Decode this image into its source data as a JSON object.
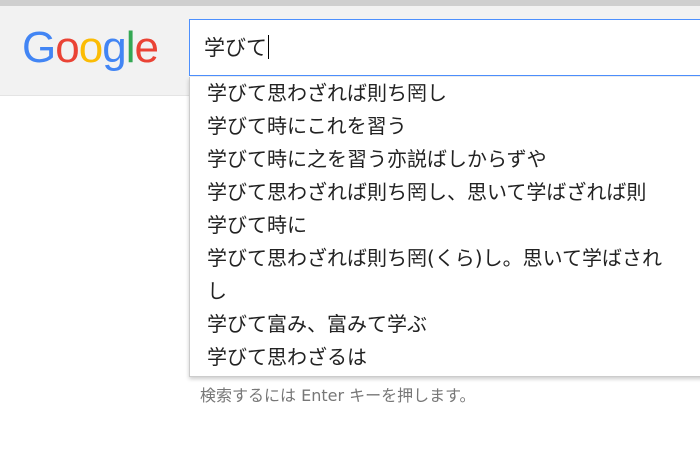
{
  "logo": {
    "letters": [
      "G",
      "o",
      "o",
      "g",
      "l",
      "e"
    ]
  },
  "search": {
    "query": "学びて"
  },
  "suggestions": [
    "学びて思わざれば則ち罔し",
    "学びて時にこれを習う",
    "学びて時に之を習う亦説ばしからずや",
    "学びて思わざれば則ち罔し、思いて学ばざれば則",
    "学びて時に",
    "学びて思わざれば則ち罔(くら)し。思いて学ばされ",
    "し",
    "学びて富み、富みて学ぶ",
    "学びて思わざるは"
  ],
  "hint": "検索するには Enter キーを押します。",
  "colors": {
    "blue": "#4285f4",
    "red": "#ea4335",
    "yellow": "#fbbc05",
    "green": "#34a853",
    "focus_border": "#4d90fe"
  }
}
